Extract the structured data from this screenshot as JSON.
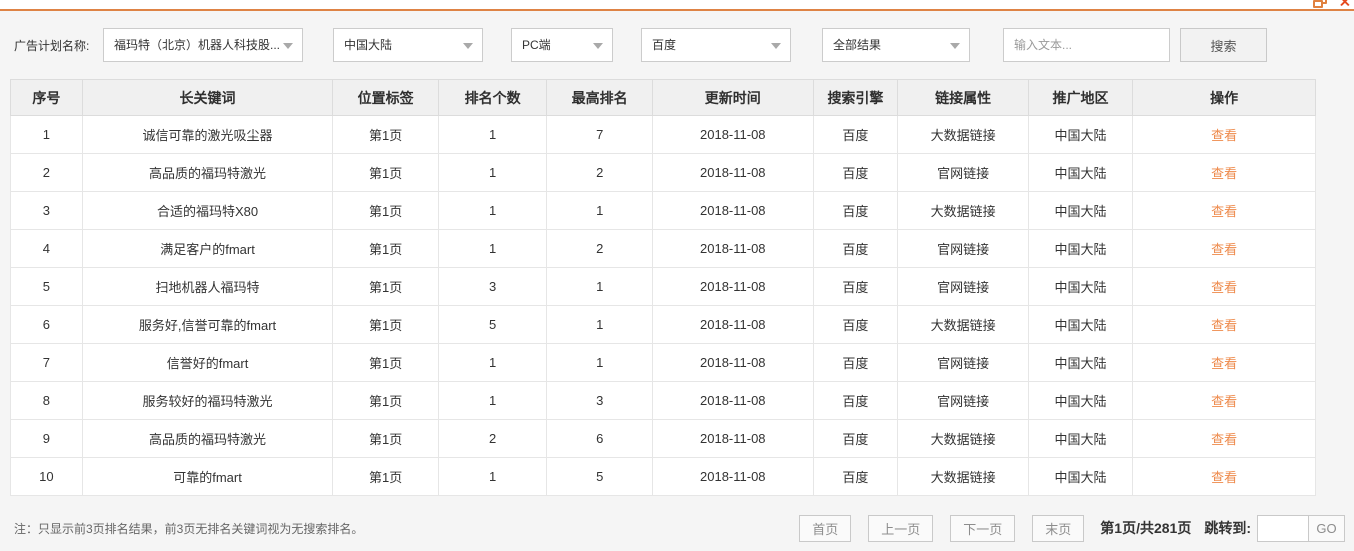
{
  "window": {
    "close_glyph": "✕"
  },
  "filters": {
    "label": "广告计划名称:",
    "dropdowns": [
      {
        "name": "ad-plan",
        "value": "福玛特（北京）机器人科技股..."
      },
      {
        "name": "region",
        "value": "中国大陆"
      },
      {
        "name": "device",
        "value": "PC端"
      },
      {
        "name": "engine",
        "value": "百度"
      },
      {
        "name": "result-type",
        "value": "全部结果"
      }
    ],
    "search_placeholder": "输入文本...",
    "search_button": "搜索"
  },
  "table": {
    "columns": [
      "序号",
      "长关键词",
      "位置标签",
      "排名个数",
      "最高排名",
      "更新时间",
      "搜索引擎",
      "链接属性",
      "推广地区",
      "操作"
    ],
    "action_label": "查看",
    "rows": [
      [
        "1",
        "诚信可靠的激光吸尘器",
        "第1页",
        "1",
        "7",
        "2018-11-08",
        "百度",
        "大数据链接",
        "中国大陆"
      ],
      [
        "2",
        "高品质的福玛特激光",
        "第1页",
        "1",
        "2",
        "2018-11-08",
        "百度",
        "官网链接",
        "中国大陆"
      ],
      [
        "3",
        "合适的福玛特X80",
        "第1页",
        "1",
        "1",
        "2018-11-08",
        "百度",
        "大数据链接",
        "中国大陆"
      ],
      [
        "4",
        "满足客户的fmart",
        "第1页",
        "1",
        "2",
        "2018-11-08",
        "百度",
        "官网链接",
        "中国大陆"
      ],
      [
        "5",
        "扫地机器人福玛特",
        "第1页",
        "3",
        "1",
        "2018-11-08",
        "百度",
        "官网链接",
        "中国大陆"
      ],
      [
        "6",
        "服务好,信誉可靠的fmart",
        "第1页",
        "5",
        "1",
        "2018-11-08",
        "百度",
        "大数据链接",
        "中国大陆"
      ],
      [
        "7",
        "信誉好的fmart",
        "第1页",
        "1",
        "1",
        "2018-11-08",
        "百度",
        "官网链接",
        "中国大陆"
      ],
      [
        "8",
        "服务较好的福玛特激光",
        "第1页",
        "1",
        "3",
        "2018-11-08",
        "百度",
        "官网链接",
        "中国大陆"
      ],
      [
        "9",
        "高品质的福玛特激光",
        "第1页",
        "2",
        "6",
        "2018-11-08",
        "百度",
        "大数据链接",
        "中国大陆"
      ],
      [
        "10",
        "可靠的fmart",
        "第1页",
        "1",
        "5",
        "2018-11-08",
        "百度",
        "大数据链接",
        "中国大陆"
      ]
    ]
  },
  "footer": {
    "note": "注：只显示前3页排名结果，前3页无排名关键词视为无搜索排名。",
    "pagination": {
      "first": "首页",
      "prev": "上一页",
      "next": "下一页",
      "last": "末页",
      "page_info": "第1页/共281页",
      "jump_label": "跳转到:",
      "go": "GO"
    }
  },
  "colors": {
    "accent_orange": "#de8345",
    "link_orange": "#ee8a4b",
    "close_red": "#e5491d",
    "header_bg": "#f0f0f0",
    "page_bg": "#f5f5f5"
  }
}
